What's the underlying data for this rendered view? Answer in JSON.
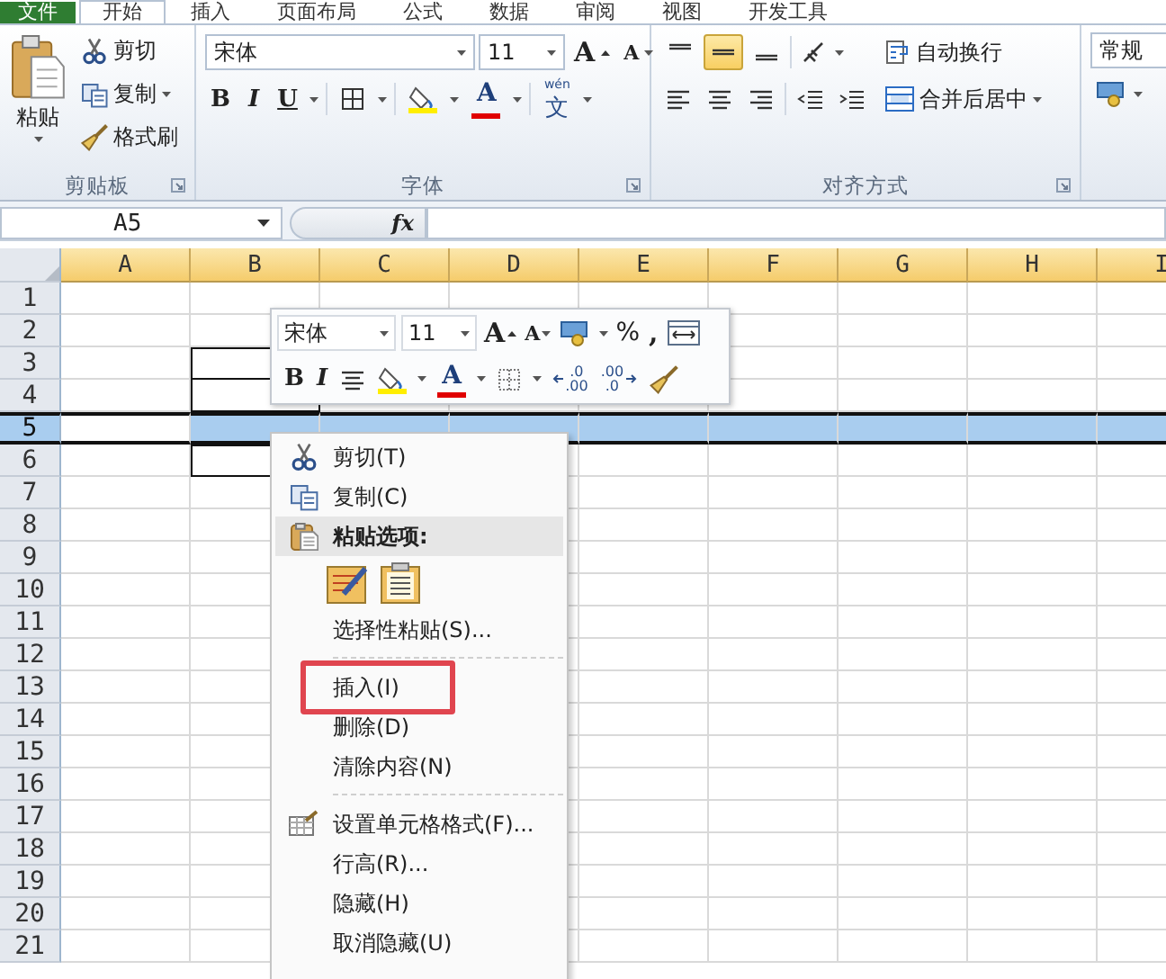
{
  "ribbon_tabs": [
    {
      "label": "文件",
      "kind": "file",
      "selected": false
    },
    {
      "label": "开始",
      "kind": "tab",
      "selected": true
    },
    {
      "label": "插入",
      "kind": "tab",
      "selected": false
    },
    {
      "label": "页面布局",
      "kind": "tab",
      "selected": false
    },
    {
      "label": "公式",
      "kind": "tab",
      "selected": false
    },
    {
      "label": "数据",
      "kind": "tab",
      "selected": false
    },
    {
      "label": "审阅",
      "kind": "tab",
      "selected": false
    },
    {
      "label": "视图",
      "kind": "tab",
      "selected": false
    },
    {
      "label": "开发工具",
      "kind": "tab",
      "selected": false
    }
  ],
  "clipboard": {
    "paste": "粘贴",
    "cut": "剪切",
    "copy": "复制",
    "format_painter": "格式刷",
    "label": "剪贴板"
  },
  "font": {
    "name": "宋体",
    "size": "11",
    "grow": "A",
    "shrink": "A",
    "bold": "B",
    "italic": "I",
    "underline": "U",
    "font_color": "A",
    "phonetic_top": "wén",
    "phonetic": "文",
    "label": "字体"
  },
  "alignment": {
    "vertical": [
      {
        "selected": false
      },
      {
        "selected": true
      },
      {
        "selected": false
      }
    ],
    "wrap_text": "自动换行",
    "merge_center": "合并后居中",
    "label": "对齐方式"
  },
  "number": {
    "format": "常规"
  },
  "formula_bar": {
    "name_box": "A5",
    "function": "fx"
  },
  "sheet": {
    "columns": [
      "A",
      "B",
      "C",
      "D",
      "E",
      "F",
      "G",
      "H",
      "I"
    ],
    "rows": [
      {
        "label": "1",
        "selected": false
      },
      {
        "label": "2",
        "selected": false
      },
      {
        "label": "3",
        "selected": false
      },
      {
        "label": "4",
        "selected": false
      },
      {
        "label": "5",
        "selected": true
      },
      {
        "label": "6",
        "selected": false
      },
      {
        "label": "7",
        "selected": false
      },
      {
        "label": "8",
        "selected": false
      },
      {
        "label": "9",
        "selected": false
      },
      {
        "label": "10",
        "selected": false
      },
      {
        "label": "11",
        "selected": false
      },
      {
        "label": "12",
        "selected": false
      },
      {
        "label": "13",
        "selected": false
      },
      {
        "label": "14",
        "selected": false
      },
      {
        "label": "15",
        "selected": false
      },
      {
        "label": "16",
        "selected": false
      },
      {
        "label": "17",
        "selected": false
      },
      {
        "label": "18",
        "selected": false
      },
      {
        "label": "19",
        "selected": false
      },
      {
        "label": "20",
        "selected": false
      },
      {
        "label": "21",
        "selected": false
      }
    ]
  },
  "mini_toolbar": {
    "font": "宋体",
    "size": "11",
    "grow": "A",
    "shrink": "A",
    "percent": "%",
    "comma": ",",
    "bold": "B",
    "italic": "I",
    "font_color": "A",
    "increase_decimal": [
      ".0",
      ".00"
    ],
    "decrease_decimal": [
      ".00",
      ".0"
    ]
  },
  "context_menu": {
    "items": [
      {
        "kind": "command",
        "label": "剪切(T)",
        "highlighted": false
      },
      {
        "kind": "command",
        "label": "复制(C)",
        "highlighted": false
      },
      {
        "kind": "header",
        "label": "粘贴选项:"
      },
      {
        "kind": "paste_options"
      },
      {
        "kind": "command",
        "label": "选择性粘贴(S)...",
        "highlighted": false
      },
      {
        "kind": "separator"
      },
      {
        "kind": "command",
        "label": "插入(I)",
        "highlighted": true
      },
      {
        "kind": "command",
        "label": "删除(D)",
        "highlighted": false
      },
      {
        "kind": "command",
        "label": "清除内容(N)",
        "highlighted": false
      },
      {
        "kind": "separator"
      },
      {
        "kind": "command",
        "label": "设置单元格格式(F)...",
        "highlighted": false
      },
      {
        "kind": "command",
        "label": "行高(R)...",
        "highlighted": false
      },
      {
        "kind": "command",
        "label": "隐藏(H)",
        "highlighted": false
      },
      {
        "kind": "command",
        "label": "取消隐藏(U)",
        "highlighted": false
      }
    ]
  }
}
